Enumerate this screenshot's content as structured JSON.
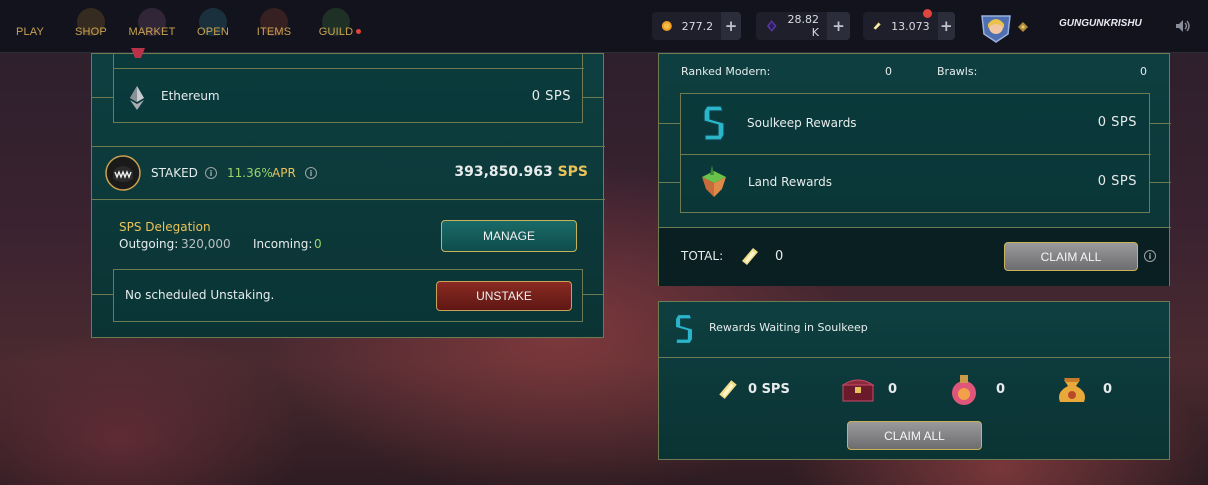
{
  "nav": {
    "items": [
      "PLAY",
      "SHOP",
      "MARKET",
      "OPEN",
      "ITEMS",
      "GUILD"
    ]
  },
  "resources": {
    "dec": "277.2",
    "voucher": "28.82 K",
    "sps": "13.073"
  },
  "user": {
    "name": "GUNGUNKRISHU"
  },
  "left": {
    "ethereum_label": "Ethereum",
    "ethereum_value": "0 SPS",
    "staked_label": "STAKED",
    "apr_value": "11.36%",
    "apr_label": "APR",
    "staked_amount": "393,850.963",
    "staked_unit": "SPS",
    "delegation_title": "SPS Delegation",
    "outgoing_label": "Outgoing:",
    "outgoing_value": "320,000",
    "incoming_label": "Incoming:",
    "incoming_value": "0",
    "manage_label": "MANAGE",
    "unstaking_text": "No scheduled Unstaking.",
    "unstake_label": "UNSTAKE"
  },
  "right": {
    "ranked_modern_label": "Ranked Modern:",
    "ranked_modern_value": "0",
    "brawls_label": "Brawls:",
    "brawls_value": "0",
    "soulkeep_rewards_label": "Soulkeep Rewards",
    "soulkeep_rewards_value": "0 SPS",
    "land_rewards_label": "Land Rewards",
    "land_rewards_value": "0 SPS",
    "total_label": "TOTAL:",
    "total_value": "0",
    "claim_all_label": "CLAIM ALL",
    "waiting_title": "Rewards Waiting in Soulkeep",
    "waiting_sps": "0 SPS",
    "waiting_chest": "0",
    "waiting_potion": "0",
    "waiting_bag": "0",
    "claim_all_label_2": "CLAIM ALL"
  },
  "colors": {
    "accent_gold": "#e8c35a",
    "accent_green": "#9bd36b",
    "panel_teal": "#0e3f40",
    "border": "#6e7a52"
  }
}
